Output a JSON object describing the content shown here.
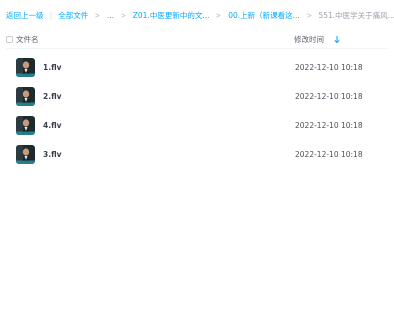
{
  "breadcrumb": {
    "back_label": "返回上一级",
    "items": [
      "全部文件",
      "...",
      "Z01.中医更新中的文...",
      "00.上新（新课看这...",
      "551.中医学关于痛风..."
    ]
  },
  "table": {
    "header_name": "文件名",
    "header_time": "修改时间",
    "sort_icon": "sort-descending-arrow-icon",
    "rows": [
      {
        "name": "1.flv",
        "time": "2022-12-10 10:18",
        "icon": "video-thumbnail"
      },
      {
        "name": "2.flv",
        "time": "2022-12-10 10:18",
        "icon": "video-thumbnail"
      },
      {
        "name": "4.flv",
        "time": "2022-12-10 10:18",
        "icon": "video-thumbnail"
      },
      {
        "name": "3.flv",
        "time": "2022-12-10 10:18",
        "icon": "video-thumbnail"
      }
    ]
  },
  "colors": {
    "link": "#06a7ff",
    "current_crumb": "#9aa0ab",
    "text": "#3a3f48"
  }
}
